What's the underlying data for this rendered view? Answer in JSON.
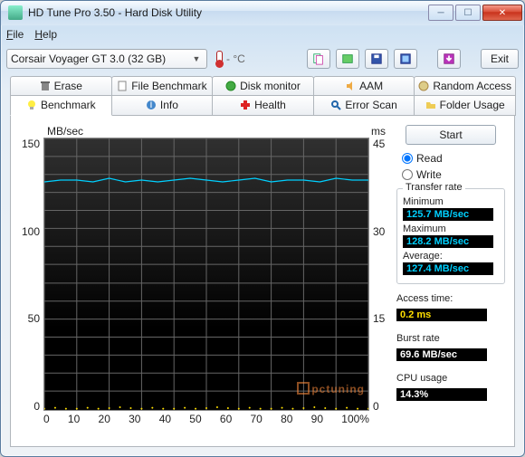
{
  "window": {
    "title": "HD Tune Pro 3.50 - Hard Disk Utility"
  },
  "menu": {
    "file": "File",
    "help": "Help"
  },
  "toolbar": {
    "drive_selected": "Corsair Voyager GT 3.0 (32 GB)",
    "temp": "- °C",
    "exit": "Exit"
  },
  "tabs_top": [
    {
      "label": "Erase",
      "icon": "trash-icon"
    },
    {
      "label": "File Benchmark",
      "icon": "file-icon"
    },
    {
      "label": "Disk monitor",
      "icon": "monitor-icon"
    },
    {
      "label": "AAM",
      "icon": "sound-icon"
    },
    {
      "label": "Random Access",
      "icon": "random-icon"
    }
  ],
  "tabs_bottom": [
    {
      "label": "Benchmark",
      "icon": "bulb-icon",
      "active": true
    },
    {
      "label": "Info",
      "icon": "info-icon"
    },
    {
      "label": "Health",
      "icon": "health-icon"
    },
    {
      "label": "Error Scan",
      "icon": "search-icon"
    },
    {
      "label": "Folder Usage",
      "icon": "folder-icon"
    }
  ],
  "benchmark": {
    "start": "Start",
    "read": "Read",
    "write": "Write",
    "mode_selected": "read",
    "transfer_label": "Transfer rate",
    "min_label": "Minimum",
    "min_val": "125.7 MB/sec",
    "max_label": "Maximum",
    "max_val": "128.2 MB/sec",
    "avg_label": "Average:",
    "avg_val": "127.4 MB/sec",
    "access_label": "Access time:",
    "access_val": "0.2 ms",
    "burst_label": "Burst rate",
    "burst_val": "69.6 MB/sec",
    "cpu_label": "CPU usage",
    "cpu_val": "14.3%"
  },
  "chart_data": {
    "type": "line",
    "title": "",
    "xlabel": "%",
    "ylabel_left": "MB/sec",
    "ylabel_right": "ms",
    "x_ticks": [
      "0",
      "10",
      "20",
      "30",
      "40",
      "50",
      "60",
      "70",
      "80",
      "90",
      "100%"
    ],
    "y_ticks_left": [
      "150",
      "100",
      "50",
      "0"
    ],
    "y_ticks_right": [
      "45",
      "30",
      "15",
      "0"
    ],
    "ylim_left": [
      0,
      150
    ],
    "ylim_right": [
      0,
      45
    ],
    "series": [
      {
        "name": "Transfer rate (MB/s)",
        "axis": "left",
        "color": "#00d0ff",
        "x": [
          0,
          5,
          10,
          15,
          20,
          25,
          30,
          35,
          40,
          45,
          50,
          55,
          60,
          65,
          70,
          75,
          80,
          85,
          90,
          95,
          100
        ],
        "values": [
          126,
          127,
          127,
          126,
          128,
          126,
          127,
          126,
          127,
          128,
          127,
          126,
          127,
          128,
          126,
          127,
          127,
          126,
          128,
          127,
          127
        ]
      },
      {
        "name": "Access time (ms)",
        "axis": "right",
        "color": "#ffe000",
        "x": [
          0,
          10,
          20,
          30,
          40,
          50,
          60,
          70,
          80,
          90,
          100
        ],
        "values": [
          0.2,
          0.2,
          0.3,
          0.2,
          0.2,
          0.3,
          0.2,
          0.2,
          0.3,
          0.2,
          0.2
        ]
      }
    ]
  },
  "watermark": "pctuning"
}
